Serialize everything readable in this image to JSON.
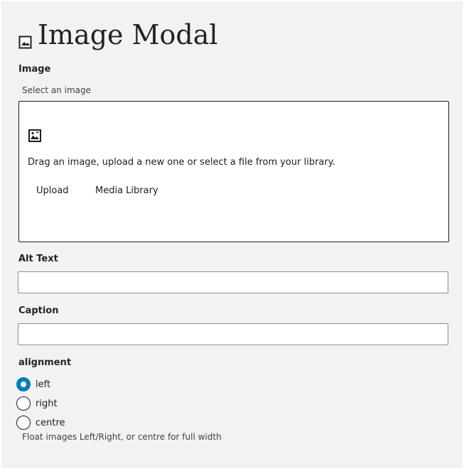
{
  "header": {
    "title": "Image Modal",
    "icon": "image-icon"
  },
  "image_field": {
    "label": "Image",
    "help": "Select an image",
    "dropzone": {
      "icon": "image-placeholder-icon",
      "instructions": "Drag an image, upload a new one or select a file from your library.",
      "upload_label": "Upload",
      "media_library_label": "Media Library"
    }
  },
  "alt_text": {
    "label": "Alt Text",
    "value": ""
  },
  "caption": {
    "label": "Caption",
    "value": ""
  },
  "alignment": {
    "label": "alignment",
    "options": [
      {
        "label": "left",
        "checked": true
      },
      {
        "label": "right",
        "checked": false
      },
      {
        "label": "centre",
        "checked": false
      }
    ],
    "help": "Float images Left/Right, or centre for full width"
  },
  "colors": {
    "accent": "#007cba",
    "panel_bg": "#f2f2f2"
  }
}
